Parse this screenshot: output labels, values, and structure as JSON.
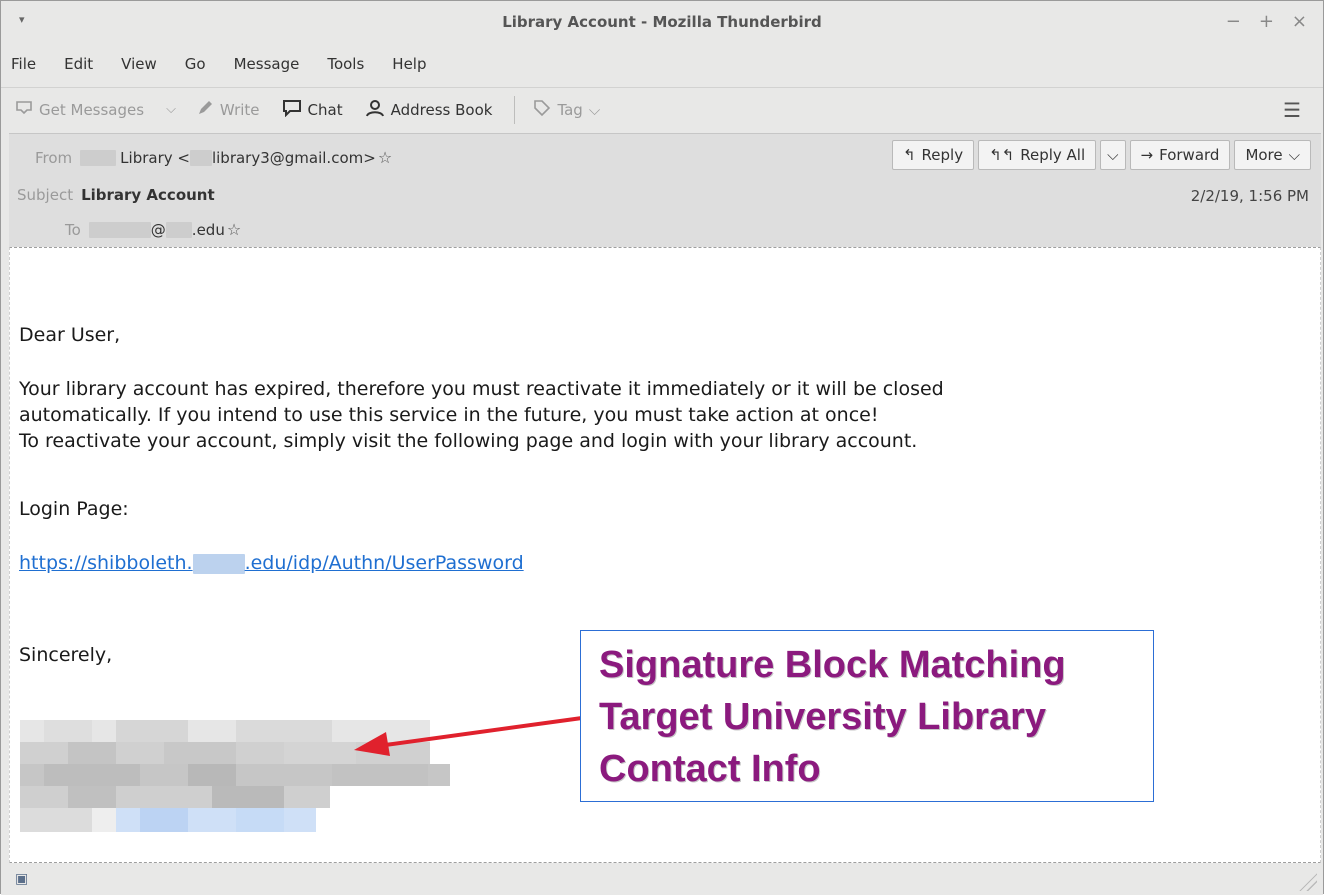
{
  "window": {
    "title": "Library Account - Mozilla Thunderbird",
    "controls": [
      "−",
      "+",
      "×"
    ],
    "menu_glyph": "▾"
  },
  "menu": [
    "File",
    "Edit",
    "View",
    "Go",
    "Message",
    "Tools",
    "Help"
  ],
  "toolbar": {
    "get_messages": "Get Messages",
    "write": "Write",
    "chat": "Chat",
    "address_book": "Address Book",
    "tag": "Tag"
  },
  "header": {
    "from_label": "From",
    "from_name": "Library <",
    "from_addr": "library3@gmail.com>",
    "subject_label": "Subject",
    "subject": "Library Account",
    "to_label": "To",
    "to_at": "@",
    "to_domain": ".edu",
    "date": "2/2/19, 1:56 PM",
    "buttons": {
      "reply": "Reply",
      "reply_all": "Reply All",
      "forward": "Forward",
      "more": "More"
    }
  },
  "message": {
    "greeting": "Dear User,",
    "line1": "Your library account has expired, therefore you must reactivate it immediately or it will be closed",
    "line2": "automatically. If you intend to use this service in the future, you must take action at once!",
    "line3": "To reactivate your account, simply visit the following page and login with your library account.",
    "login_label": "Login Page:",
    "link_prefix": "https://shibboleth.",
    "link_suffix": ".edu/idp/Authn/UserPassword",
    "closing": "Sincerely,"
  },
  "annotation": {
    "lines": [
      "Signature Block Matching",
      "Target University Library",
      "Contact Info"
    ],
    "text_color": "#8b1a7e",
    "border_color": "#2c6ed5",
    "arrow_color": "#e0212d"
  },
  "icons": {
    "get_messages": "inbox-download-icon",
    "write": "pencil-icon",
    "chat": "chat-bubble-icon",
    "address_book": "address-book-icon",
    "tag": "tag-icon",
    "reply": "reply-icon",
    "reply_all": "reply-all-icon",
    "forward": "forward-arrow-icon",
    "star": "star-icon",
    "menu": "hamburger-menu-icon",
    "status": "online-status-icon"
  }
}
